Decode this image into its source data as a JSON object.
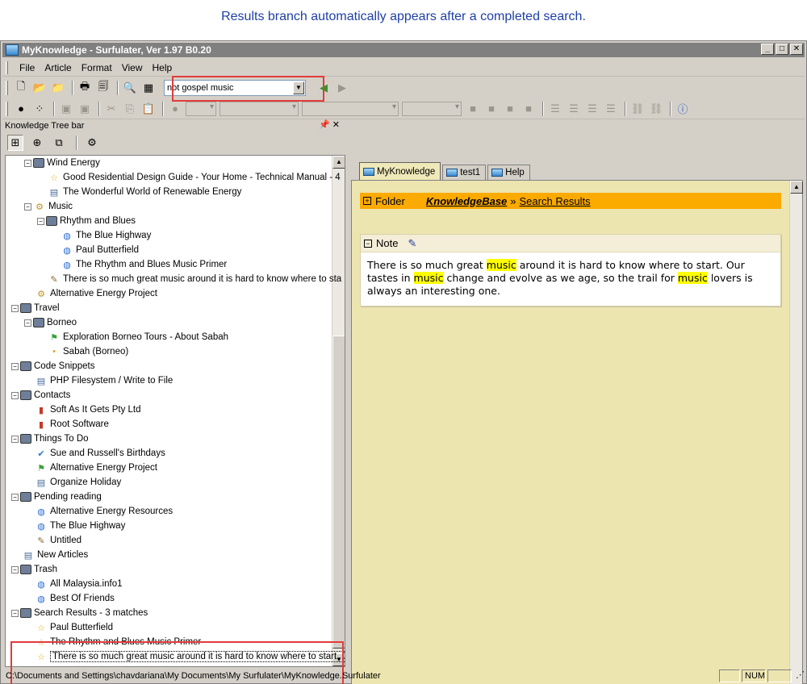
{
  "caption": "Results branch automatically appears after a completed search.",
  "window": {
    "title": "MyKnowledge - Surfulater, Ver 1.97 B0.20"
  },
  "menu": [
    "File",
    "Article",
    "Format",
    "View",
    "Help"
  ],
  "search": {
    "value": "not gospel music"
  },
  "left_pane": {
    "title": "Knowledge Tree bar"
  },
  "tree": [
    {
      "label": "Wind Energy",
      "icon": "book",
      "toggle": "−",
      "level": 1
    },
    {
      "label": "Good Residential Design Guide - Your Home - Technical Manual - 4",
      "icon": "star",
      "level": 2
    },
    {
      "label": "The Wonderful World of Renewable Energy",
      "icon": "doc",
      "level": 2
    },
    {
      "label": "Music",
      "icon": "energy",
      "toggle": "−",
      "level": 1
    },
    {
      "label": "Rhythm and Blues",
      "icon": "book",
      "toggle": "−",
      "level": 2
    },
    {
      "label": "The Blue Highway",
      "icon": "globe",
      "level": 3
    },
    {
      "label": "Paul Butterfield",
      "icon": "globe",
      "level": 3
    },
    {
      "label": "The Rhythm and Blues Music Primer",
      "icon": "globe",
      "level": 3
    },
    {
      "label": "There is so much great music around it is hard to know where to sta",
      "icon": "note",
      "level": 2
    },
    {
      "label": "Alternative Energy Project",
      "icon": "energy",
      "level": 1
    },
    {
      "label": "Travel",
      "icon": "book",
      "toggle": "−",
      "level": 0
    },
    {
      "label": "Borneo",
      "icon": "book",
      "toggle": "−",
      "level": 1
    },
    {
      "label": "Exploration Borneo Tours - About Sabah",
      "icon": "flag",
      "level": 2
    },
    {
      "label": "Sabah (Borneo)",
      "icon": "dot",
      "level": 2
    },
    {
      "label": "Code Snippets",
      "icon": "book",
      "toggle": "−",
      "level": 0
    },
    {
      "label": "PHP Filesystem / Write to File",
      "icon": "doc",
      "level": 1
    },
    {
      "label": "Contacts",
      "icon": "book",
      "toggle": "−",
      "level": 0
    },
    {
      "label": "Soft As It Gets Pty Ltd",
      "icon": "gift",
      "level": 1
    },
    {
      "label": "Root Software",
      "icon": "gift",
      "level": 1
    },
    {
      "label": "Things To Do",
      "icon": "book",
      "toggle": "−",
      "level": 0
    },
    {
      "label": "Sue and Russell's Birthdays",
      "icon": "check",
      "level": 1
    },
    {
      "label": "Alternative Energy Project",
      "icon": "flag",
      "level": 1
    },
    {
      "label": "Organize Holiday",
      "icon": "doc",
      "level": 1
    },
    {
      "label": "Pending reading",
      "icon": "book",
      "toggle": "−",
      "level": 0
    },
    {
      "label": "Alternative Energy Resources",
      "icon": "globe",
      "level": 1
    },
    {
      "label": "The Blue Highway",
      "icon": "globe",
      "level": 1
    },
    {
      "label": "Untitled",
      "icon": "note",
      "level": 1
    },
    {
      "label": "New Articles",
      "icon": "doc",
      "level": 0
    },
    {
      "label": "Trash",
      "icon": "book",
      "toggle": "−",
      "level": 0
    },
    {
      "label": "All Malaysia.info1",
      "icon": "globe",
      "level": 1
    },
    {
      "label": "Best Of Friends",
      "icon": "globe",
      "level": 1
    },
    {
      "label": "Search Results - 3 matches",
      "icon": "book",
      "toggle": "−",
      "level": 0
    },
    {
      "label": "Paul Butterfield",
      "icon": "star",
      "level": 1
    },
    {
      "label": "The Rhythm and Blues Music Primer",
      "icon": "star",
      "level": 1
    },
    {
      "label": "There is so much great music around it is hard to know where to start. C",
      "icon": "star",
      "level": 1,
      "selected": true
    }
  ],
  "tabs": [
    "MyKnowledge",
    "test1",
    "Help"
  ],
  "folder_bar": {
    "label": "Folder",
    "root": "KnowledgeBase",
    "separator": "»",
    "leaf": "Search Results"
  },
  "note": {
    "title": "Note",
    "segments": [
      {
        "t": "There is so much great "
      },
      {
        "t": "music",
        "hl": true
      },
      {
        "t": " around it is hard to know where to start. Our tastes in "
      },
      {
        "t": "music",
        "hl": true
      },
      {
        "t": " change and evolve as we age, so the trail for "
      },
      {
        "t": "music",
        "hl": true
      },
      {
        "t": " lovers is always an interesting one."
      }
    ]
  },
  "status": {
    "path": "C:\\Documents and Settings\\chavdariana\\My Documents\\My Surfulater\\MyKnowledge.Surfulater",
    "num": "NUM"
  }
}
